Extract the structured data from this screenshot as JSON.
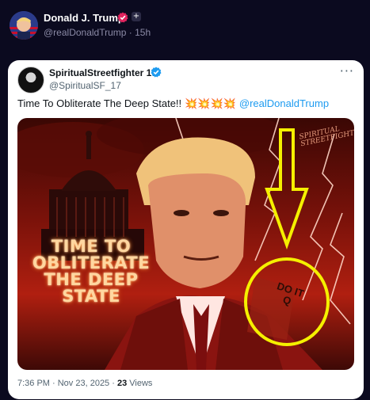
{
  "post": {
    "author_name": "Donald J. Trump",
    "plus_badge": "+",
    "handle_time": "@realDonaldTrump · 15h"
  },
  "quoted": {
    "author_name": "SpiritualStreetfighter 17",
    "handle": "@SpiritualSF_17",
    "more": "···",
    "text": "Time To Obliterate The Deep State!!",
    "bursts": "💥💥💥💥",
    "mention": "@realDonaldTrump",
    "image": {
      "overlay_text_1": "TIME TO",
      "overlay_text_2": "OBLITERATE",
      "overlay_text_3": "THE DEEP",
      "overlay_text_4": "STATE",
      "lapel_line_1": "DO IT",
      "lapel_line_2": "Q",
      "watermark_1": "SPIRITUAL",
      "watermark_2": "STREETFIGHTER",
      "annotation_color": "#f5f000"
    },
    "footer": {
      "time_date": "7:36 PM · Nov 23, 2025 · ",
      "views_count": "23",
      "views_label": " Views"
    }
  },
  "colors": {
    "page_bg": "#0b0a1f",
    "link_blue": "#1d9bf0",
    "verified_red": "#e0245e"
  },
  "icons": [
    "avatar-trump",
    "verified-badge-icon",
    "plus-badge-icon",
    "blue-verified-icon",
    "more-options-icon"
  ]
}
